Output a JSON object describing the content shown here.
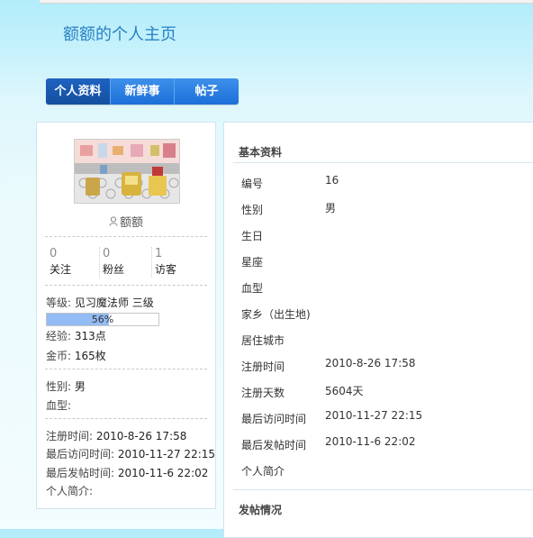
{
  "page": {
    "title": "额额的个人主页"
  },
  "tabs": [
    {
      "label": "个人资料",
      "active": true
    },
    {
      "label": "新鲜事",
      "active": false
    },
    {
      "label": "帖子",
      "active": false
    }
  ],
  "profile": {
    "username": "额额",
    "stats": [
      {
        "value": "0",
        "label": "关注"
      },
      {
        "value": "0",
        "label": "粉丝"
      },
      {
        "value": "1",
        "label": "访客"
      }
    ],
    "level_label": "等级:",
    "level_value": "见习魔法师 三级",
    "progress": {
      "percent": 56,
      "text": "56%"
    },
    "exp_label": "经验:",
    "exp_value": "313点",
    "coin_label": "金币:",
    "coin_value": "165枚",
    "gender_label": "性别:",
    "gender_value": "男",
    "blood_label": "血型:",
    "register_label": "注册时间:",
    "register_value": "2010-8-26 17:58",
    "last_visit_label": "最后访问时间:",
    "last_visit_value": "2010-11-27 22:15",
    "last_post_label": "最后发帖时间:",
    "last_post_value": "2010-11-6 22:02",
    "intro_label": "个人简介:"
  },
  "basic": {
    "title": "基本资料",
    "fields": [
      {
        "label": "编号",
        "value": "16"
      },
      {
        "label": "性别",
        "value": "男"
      },
      {
        "label": "生日",
        "value": ""
      },
      {
        "label": "星座",
        "value": ""
      },
      {
        "label": "血型",
        "value": ""
      },
      {
        "label": "家乡（出生地)",
        "value": ""
      },
      {
        "label": "居住城市",
        "value": ""
      },
      {
        "label": "注册时间",
        "value": "2010-8-26 17:58"
      },
      {
        "label": "注册天数",
        "value": "5604天"
      },
      {
        "label": "最后访问时间",
        "value": "2010-11-27 22:15"
      },
      {
        "label": "最后发帖时间",
        "value": "2010-11-6 22:02"
      },
      {
        "label": "个人简介",
        "value": ""
      }
    ]
  },
  "posts": {
    "title": "发帖情况"
  },
  "colors": {
    "accent": "#2a80c4",
    "tab_bg": "#2a7fe0",
    "tab_active": "#1a58b0",
    "progress": "#93bbf4"
  }
}
